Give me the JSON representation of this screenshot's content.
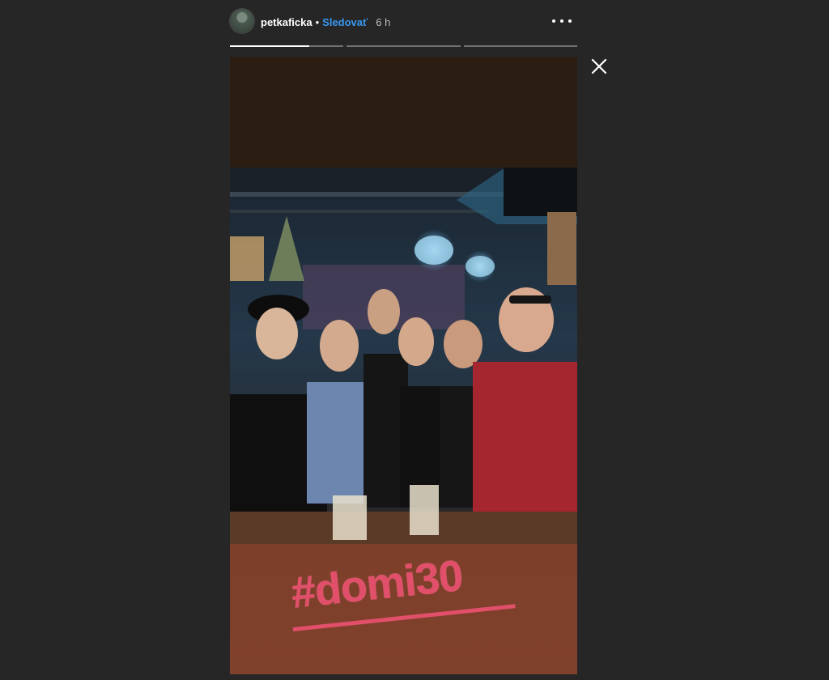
{
  "header": {
    "username": "petkaficka",
    "separator": "•",
    "follow_label": "Sledovať",
    "time": "6 h"
  },
  "progress": {
    "segments": 3,
    "current_fill": 0.7
  },
  "icons": {
    "more": "more-options-icon",
    "close": "close-icon"
  },
  "story": {
    "hashtag": "#domi30"
  },
  "colors": {
    "background": "#262626",
    "follow_link": "#3897f0",
    "hashtag": "#e14f6a",
    "story_bottom": "#7d3f2a"
  }
}
